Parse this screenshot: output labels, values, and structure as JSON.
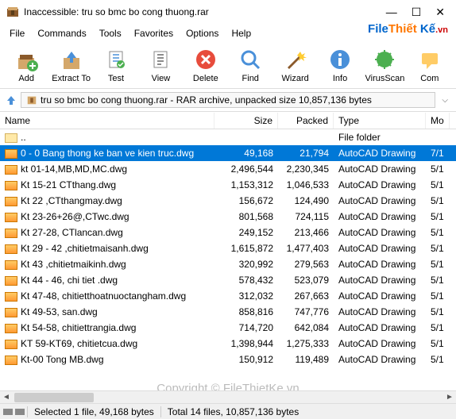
{
  "title": "Inaccessible: tru so bmc bo cong thuong.rar",
  "menu": [
    "File",
    "Commands",
    "Tools",
    "Favorites",
    "Options",
    "Help"
  ],
  "brand": {
    "file": "File",
    "thiet": "Thiết",
    "ke": "Kế",
    "vn": ".vn"
  },
  "toolbar": [
    {
      "label": "Add",
      "icon": "add"
    },
    {
      "label": "Extract To",
      "icon": "extract"
    },
    {
      "label": "Test",
      "icon": "test"
    },
    {
      "label": "View",
      "icon": "view"
    },
    {
      "label": "Delete",
      "icon": "delete"
    },
    {
      "label": "Find",
      "icon": "find"
    },
    {
      "label": "Wizard",
      "icon": "wizard"
    },
    {
      "label": "Info",
      "icon": "info"
    },
    {
      "label": "VirusScan",
      "icon": "virus"
    },
    {
      "label": "Com",
      "icon": "comment"
    }
  ],
  "path": "tru so bmc bo cong thuong.rar - RAR archive, unpacked size 10,857,136 bytes",
  "columns": {
    "name": "Name",
    "size": "Size",
    "packed": "Packed",
    "type": "Type",
    "mod": "Mo"
  },
  "parent_row": {
    "name": "..",
    "type": "File folder"
  },
  "files": [
    {
      "name": "0 - 0 Bang thong ke ban ve kien truc.dwg",
      "size": "49,168",
      "packed": "21,794",
      "type": "AutoCAD Drawing",
      "mod": "7/1",
      "selected": true
    },
    {
      "name": "kt 01-14,MB,MD,MC.dwg",
      "size": "2,496,544",
      "packed": "2,230,345",
      "type": "AutoCAD Drawing",
      "mod": "5/1"
    },
    {
      "name": "Kt 15-21 CTthang.dwg",
      "size": "1,153,312",
      "packed": "1,046,533",
      "type": "AutoCAD Drawing",
      "mod": "5/1"
    },
    {
      "name": "Kt 22 ,CTthangmay.dwg",
      "size": "156,672",
      "packed": "124,490",
      "type": "AutoCAD Drawing",
      "mod": "5/1"
    },
    {
      "name": "Kt 23-26+26@,CTwc.dwg",
      "size": "801,568",
      "packed": "724,115",
      "type": "AutoCAD Drawing",
      "mod": "5/1"
    },
    {
      "name": "Kt 27-28, CTlancan.dwg",
      "size": "249,152",
      "packed": "213,466",
      "type": "AutoCAD Drawing",
      "mod": "5/1"
    },
    {
      "name": "Kt 29 - 42 ,chitietmaisanh.dwg",
      "size": "1,615,872",
      "packed": "1,477,403",
      "type": "AutoCAD Drawing",
      "mod": "5/1"
    },
    {
      "name": "Kt 43 ,chitietmaikinh.dwg",
      "size": "320,992",
      "packed": "279,563",
      "type": "AutoCAD Drawing",
      "mod": "5/1"
    },
    {
      "name": "Kt 44 - 46, chi tiet .dwg",
      "size": "578,432",
      "packed": "523,079",
      "type": "AutoCAD Drawing",
      "mod": "5/1"
    },
    {
      "name": "Kt 47-48, chitietthoatnuoctangham.dwg",
      "size": "312,032",
      "packed": "267,663",
      "type": "AutoCAD Drawing",
      "mod": "5/1"
    },
    {
      "name": "Kt 49-53, san.dwg",
      "size": "858,816",
      "packed": "747,776",
      "type": "AutoCAD Drawing",
      "mod": "5/1"
    },
    {
      "name": "Kt 54-58, chitiettrangia.dwg",
      "size": "714,720",
      "packed": "642,084",
      "type": "AutoCAD Drawing",
      "mod": "5/1"
    },
    {
      "name": "KT 59-KT69, chitietcua.dwg",
      "size": "1,398,944",
      "packed": "1,275,333",
      "type": "AutoCAD Drawing",
      "mod": "5/1"
    },
    {
      "name": "Kt-00 Tong MB.dwg",
      "size": "150,912",
      "packed": "119,489",
      "type": "AutoCAD Drawing",
      "mod": "5/1"
    }
  ],
  "status": {
    "selected": "Selected 1 file, 49,168 bytes",
    "total": "Total 14 files, 10,857,136 bytes"
  },
  "watermark": "Copyright © FileThietKe.vn"
}
